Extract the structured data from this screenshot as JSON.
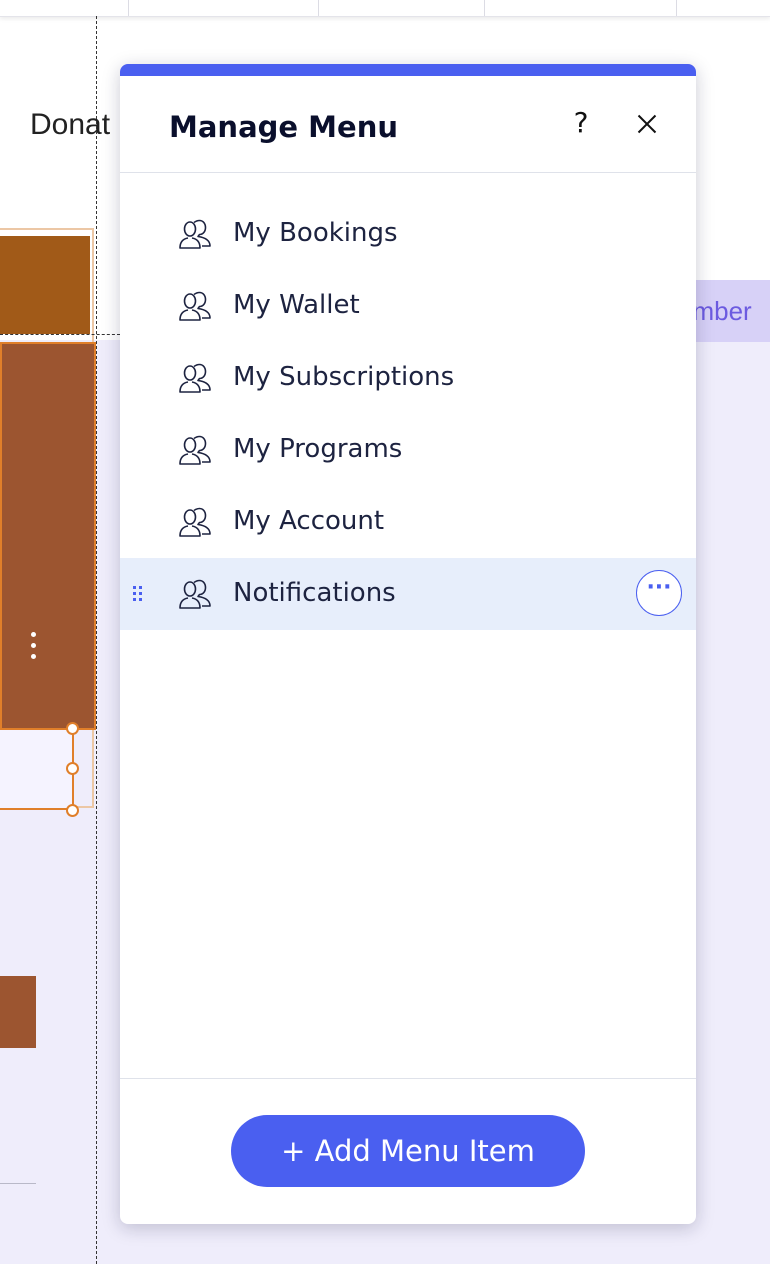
{
  "background": {
    "nav_item_text": "Donat",
    "purple_strip_text": "ember"
  },
  "panel": {
    "title": "Manage Menu",
    "help_label": "?",
    "close_icon": "close-icon",
    "items": [
      {
        "label": "My Bookings",
        "icon": "members-icon"
      },
      {
        "label": "My Wallet",
        "icon": "members-icon"
      },
      {
        "label": "My Subscriptions",
        "icon": "members-icon"
      },
      {
        "label": "My Programs",
        "icon": "members-icon"
      },
      {
        "label": "My Account",
        "icon": "members-icon"
      },
      {
        "label": "Notifications",
        "icon": "members-icon",
        "selected": true,
        "more_label": "···"
      }
    ],
    "add_button_label": "+ Add Menu Item"
  },
  "colors": {
    "accent": "#4a5ff0",
    "selected_row": "#e7eefb",
    "brown_block": "#9c5530",
    "canvas_bg": "#efedfb"
  }
}
